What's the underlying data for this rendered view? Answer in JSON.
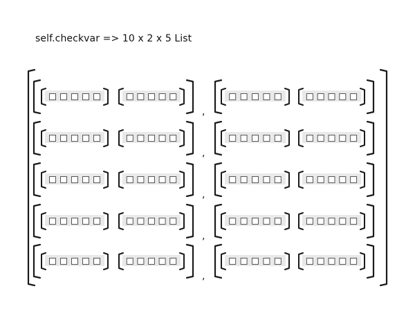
{
  "figure": {
    "title": "self.checkvar => 10 x 2 x 5 List",
    "comma_glyph": ",",
    "outer_count": 2,
    "rows_per_outer": 5,
    "lists_per_row": 2,
    "items_per_list": 5
  },
  "colors": {
    "ink": "#1a1a1a",
    "cell_border": "#555555",
    "row_shade": "#e9e9e9"
  },
  "icons": {
    "cell": "empty-square-icon"
  }
}
